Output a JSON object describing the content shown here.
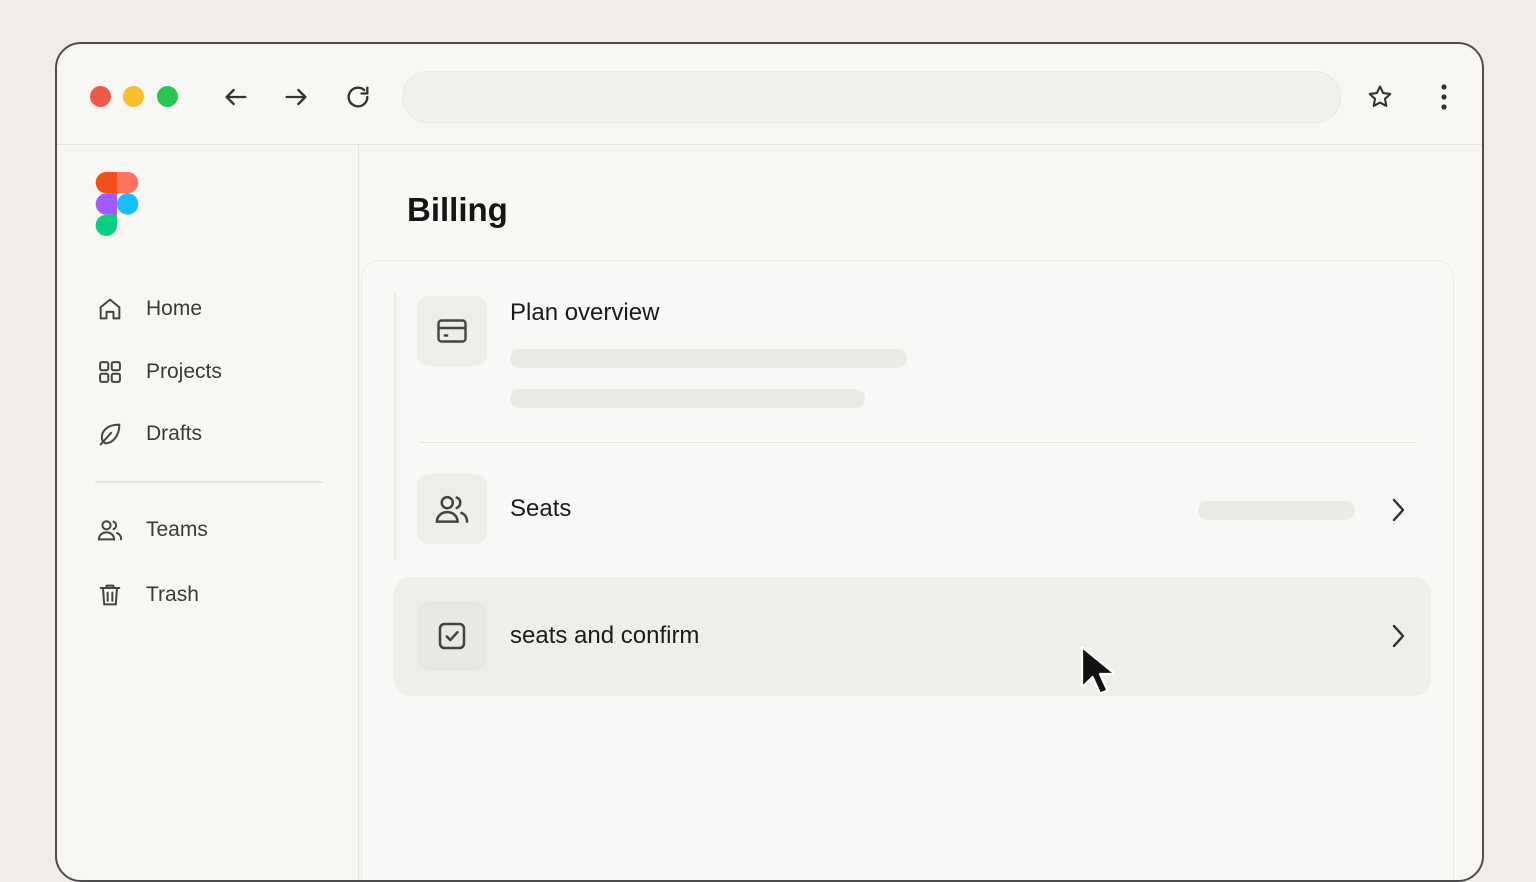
{
  "browser": {
    "address_value": "",
    "icons": {
      "back": "arrow-left-icon",
      "forward": "arrow-right-icon",
      "reload": "reload-icon",
      "bookmark": "star-icon",
      "menu": "kebab-menu-icon"
    }
  },
  "sidebar": {
    "items": [
      {
        "label": "Home",
        "icon": "home-icon"
      },
      {
        "label": "Projects",
        "icon": "grid-icon"
      },
      {
        "label": "Drafts",
        "icon": "leaf-icon"
      },
      {
        "label": "Teams",
        "icon": "users-icon"
      },
      {
        "label": "Trash",
        "icon": "trash-icon"
      }
    ]
  },
  "main": {
    "title": "Billing",
    "rows": [
      {
        "label": "Plan overview",
        "icon": "credit-card-icon"
      },
      {
        "label": "Seats",
        "icon": "users-icon"
      },
      {
        "label": "seats and confirm",
        "icon": "checkbox-icon"
      }
    ]
  },
  "colors": {
    "accent_red": "#ee5a46",
    "accent_yellow": "#f6bf2b",
    "accent_green": "#28c650"
  }
}
